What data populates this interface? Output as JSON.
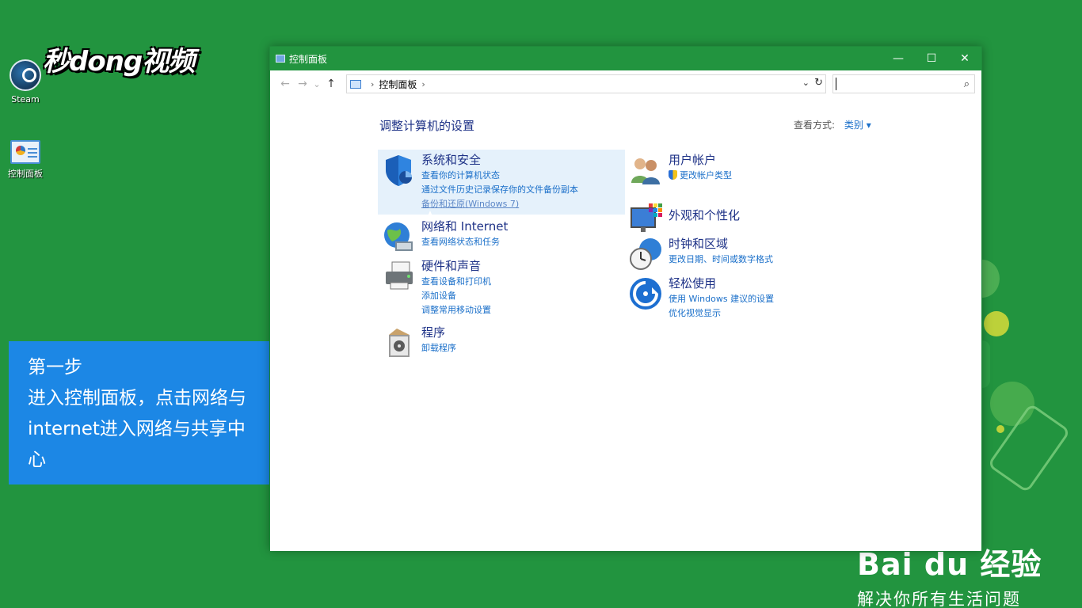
{
  "desktop": {
    "logo_text": "秒dong视频",
    "icons": [
      {
        "label": "Steam"
      },
      {
        "label": "控制面板"
      }
    ],
    "step_text": "第一步\n进入控制面板，点击网络与internet进入网络与共享中心",
    "baidu": {
      "brand": "Bai du 经验",
      "slogan": "解决你所有生活问题"
    }
  },
  "window": {
    "title": "控制面板",
    "controls": {
      "minimize": "—",
      "maximize": "☐",
      "close": "✕"
    },
    "nav": {
      "back": "←",
      "forward": "→",
      "recent": "⌄",
      "up": "↑"
    },
    "address": {
      "path": "控制面板",
      "separator": "›"
    },
    "search": {
      "placeholder": "",
      "icon": "search-icon"
    },
    "heading": "调整计算机的设置",
    "view_by": {
      "label": "查看方式:",
      "value": "类别 ▾"
    },
    "categories_left": [
      {
        "title": "系统和安全",
        "icon": "shield-icon",
        "links": [
          "查看你的计算机状态",
          "通过文件历史记录保存你的文件备份副本",
          "备份和还原(Windows 7)"
        ]
      },
      {
        "title": "网络和 Internet",
        "icon": "network-globe-icon",
        "links": [
          "查看网络状态和任务"
        ]
      },
      {
        "title": "硬件和声音",
        "icon": "printer-icon",
        "links": [
          "查看设备和打印机",
          "添加设备",
          "调整常用移动设置"
        ]
      },
      {
        "title": "程序",
        "icon": "programs-box-icon",
        "links": [
          "卸载程序"
        ]
      }
    ],
    "categories_right": [
      {
        "title": "用户帐户",
        "icon": "users-icon",
        "links": [
          "更改帐户类型"
        ]
      },
      {
        "title": "外观和个性化",
        "icon": "monitor-colors-icon",
        "links": []
      },
      {
        "title": "时钟和区域",
        "icon": "clock-globe-icon",
        "links": [
          "更改日期、时间或数字格式"
        ]
      },
      {
        "title": "轻松使用",
        "icon": "ease-of-access-icon",
        "links": [
          "使用 Windows 建议的设置",
          "优化视觉显示"
        ]
      }
    ]
  },
  "colors": {
    "desktop_green": "#22943f",
    "link_blue": "#1a6fc9",
    "title_navy": "#1e3287",
    "step_blue": "#1c87e5"
  }
}
